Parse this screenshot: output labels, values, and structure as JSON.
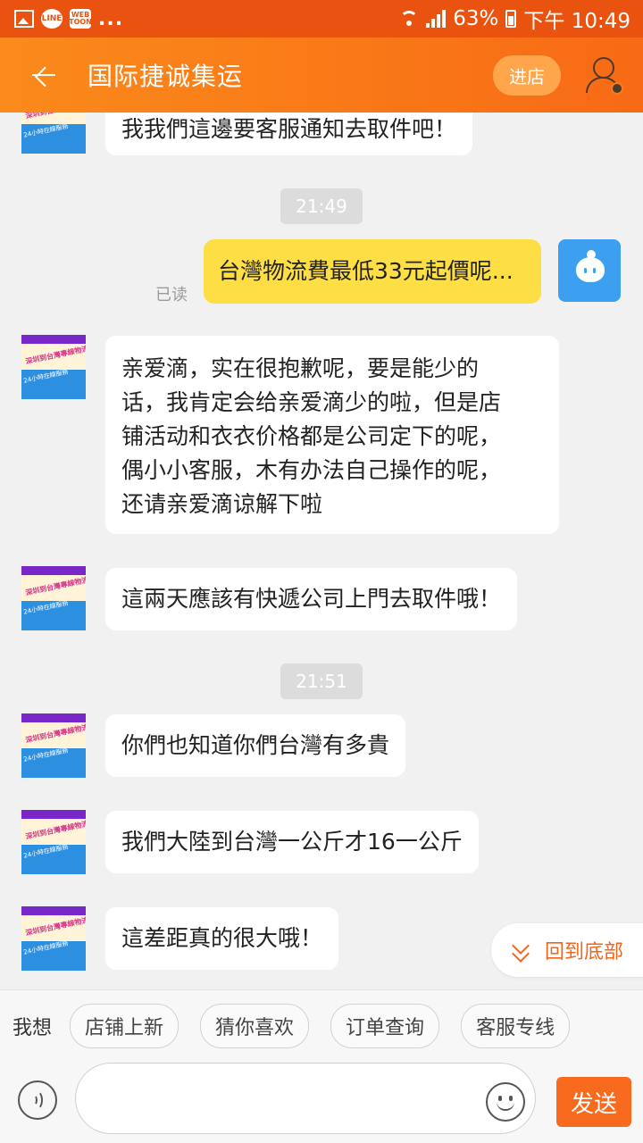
{
  "status_bar": {
    "battery": "63%",
    "time": "下午 10:49",
    "app_icons": [
      "image-icon",
      "line-icon",
      "webtoon-icon"
    ],
    "line_text": "LINE",
    "webtoon_text": "WEB TOON",
    "more": "..."
  },
  "header": {
    "title": "国际捷诚集运",
    "shop_button": "进店"
  },
  "avatar_text": {
    "top": "深圳到台灣專線物流",
    "bottom": "24小時在線服務"
  },
  "messages": [
    {
      "side": "left",
      "text": "我我們這邊要客服通知去取件吧！"
    },
    {
      "type": "time",
      "text": "21:49"
    },
    {
      "side": "right",
      "text": "台灣物流費最低33元起價呢...",
      "status": "已读"
    },
    {
      "side": "left",
      "text": "亲爱滴，实在很抱歉呢，要是能少的话，我肯定会给亲爱滴少的啦，但是店铺活动和衣衣价格都是公司定下的呢，偶小小客服，木有办法自己操作的呢，还请亲爱滴谅解下啦",
      "lines": [
        "亲爱滴，实在很抱歉呢，要是能少的",
        "话，我肯定会给亲爱滴少的啦，但是店",
        "铺活动和衣衣价格都是公司定下的呢，",
        "偶小小客服，木有办法自己操作的呢，",
        "还请亲爱滴谅解下啦"
      ]
    },
    {
      "side": "left",
      "text": "這兩天應該有快遞公司上門去取件哦！"
    },
    {
      "type": "time",
      "text": "21:51"
    },
    {
      "side": "left",
      "text": "你們也知道你們台灣有多貴"
    },
    {
      "side": "left",
      "text": "我們大陸到台灣一公斤才16一公斤"
    },
    {
      "side": "left",
      "text": "這差距真的很大哦！"
    }
  ],
  "back_to_bottom": "回到底部",
  "quick_bar": {
    "label": "我想",
    "chips": [
      "店铺上新",
      "猜你喜欢",
      "订单查询",
      "客服专线"
    ]
  },
  "input_bar": {
    "send_label": "发送",
    "value": ""
  },
  "colors": {
    "status_bar": "#e9530f",
    "header_gradient_start": "#fb8a1b",
    "header_gradient_end": "#f86a15",
    "own_bubble": "#fede45",
    "accent": "#f5641a"
  }
}
